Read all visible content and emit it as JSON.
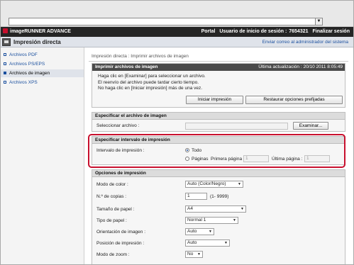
{
  "browser": {
    "address_value": "",
    "dropdown_arrow": "▼"
  },
  "header": {
    "brand": "imageRUNNER ADVANCE",
    "portal": "Portal",
    "login_label": "Usuario de inicio de sesión :",
    "login_user": "7654321",
    "logout": "Finalizar sesión"
  },
  "titlebar": {
    "title": "Impresión directa",
    "admin_link": "Enviar correo al administrador del sistema"
  },
  "sidebar": {
    "items": [
      {
        "label": "Archivos PDF"
      },
      {
        "label": "Archivos PS/EPS"
      },
      {
        "label": "Archivos de imagen"
      },
      {
        "label": "Archivos XPS"
      }
    ]
  },
  "breadcrumb": "Impresión directa : Imprimir archivos de imagen",
  "print_panel": {
    "title": "Imprimir archivos de imagen",
    "last_update": "Última actualización : 20/10 2011 8:05:49",
    "instructions": [
      "Haga clic en [Examinar] para seleccionar un archivo.",
      "El reenvío del archivo puede tardar cierto tiempo.",
      "No haga clic en [Iniciar impresión] más de una vez."
    ],
    "start_button": "Iniciar impresión",
    "reset_button": "Restaurar opciones prefijadas"
  },
  "file_section": {
    "title": "Especificar el archivo de imagen",
    "label": "Seleccionar archivo :",
    "value": "",
    "browse_button": "Examinar..."
  },
  "range_section": {
    "title": "Especificar intervalo de impresión",
    "label": "Intervalo de impresión :",
    "option_all": "Todo",
    "option_pages": "Páginas",
    "first_page_label": "Primera página :",
    "first_page_value": "1",
    "last_page_label": "Última página :",
    "last_page_value": "1"
  },
  "options_section": {
    "title": "Opciones de impresión",
    "color_mode_label": "Modo de color :",
    "color_mode_value": "Auto (Color/Negro)",
    "copies_label": "N.º de copias :",
    "copies_value": "1",
    "copies_range": "(1- 9999)",
    "paper_size_label": "Tamaño de papel :",
    "paper_size_value": "A4",
    "paper_type_label": "Tipo de papel :",
    "paper_type_value": "Normal 1",
    "orientation_label": "Orientación de imagen :",
    "orientation_value": "Auto",
    "position_label": "Posición de impresión :",
    "position_value": "Auto",
    "zoom_label": "Modo de zoom :",
    "zoom_value": "No"
  },
  "colors": {
    "accent": "#1a4f9e",
    "highlight": "#c8102e",
    "dark_header": "#252525"
  }
}
